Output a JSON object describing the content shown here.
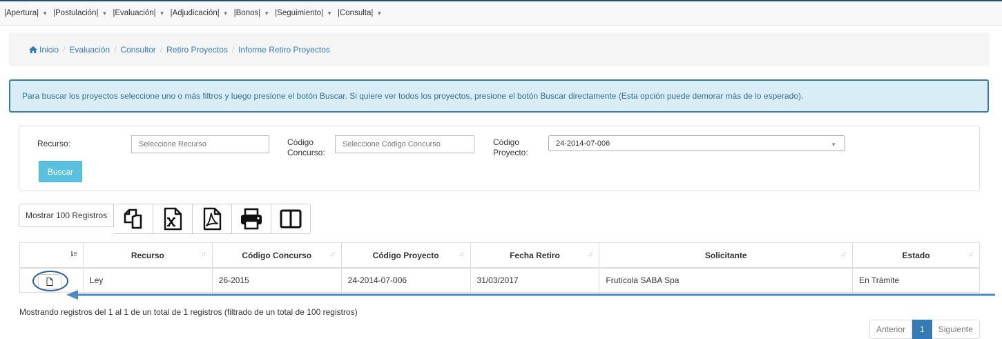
{
  "menu": [
    {
      "label": "|Apertura|"
    },
    {
      "label": "|Postulación|"
    },
    {
      "label": "|Evaluación|"
    },
    {
      "label": "|Adjudicación|"
    },
    {
      "label": "|Bonos|"
    },
    {
      "label": "|Seguimiento|"
    },
    {
      "label": "|Consulta|"
    }
  ],
  "breadcrumb": [
    "Inicio",
    "Evaluación",
    "Consultor",
    "Retiro Proyectos",
    "Informe Retiro Proyectos"
  ],
  "info_text": "Para buscar los proyectos seleccione uno o más filtros y luego presione el botón Buscar. Si quiere ver todos los proyectos, presione el botón Buscar directamente (Esta opción puede demorar más de lo esperado).",
  "filters": {
    "recurso_label": "Recurso:",
    "recurso_placeholder": "Seleccione Recurso",
    "concurso_label_1": "Código",
    "concurso_label_2": "Concurso:",
    "concurso_placeholder": "Seleccione Código Concurso",
    "proyecto_label_1": "Código",
    "proyecto_label_2": "Proyecto:",
    "proyecto_value": "24-2014-07-006",
    "buscar_label": "Buscar"
  },
  "toolbar": {
    "show_label": "Mostrar 100 Registros",
    "icons": [
      "copy-icon",
      "excel-icon",
      "pdf-icon",
      "print-icon",
      "columns-icon"
    ]
  },
  "table": {
    "headers": [
      "",
      "Recurso",
      "Código Concurso",
      "Código Proyecto",
      "Fecha Retiro",
      "Solicitante",
      "Estado"
    ],
    "rows": [
      [
        "",
        "Ley",
        "26-2015",
        "24-2014-07-006",
        "31/03/2017",
        "Frutícola SABA Spa",
        "En Trámite"
      ]
    ]
  },
  "summary": "Mostrando registros del 1 al 1 de un total de 1 registros (filtrado de un total de 100 registros)",
  "pagination": {
    "prev": "Anterior",
    "current": "1",
    "next": "Siguiente"
  },
  "colors": {
    "accent": "#337ab7",
    "info_bg": "#d9edf7",
    "info_border": "#3d7b9c",
    "buscar": "#5bc0de",
    "annotation": "#4a8ac2"
  }
}
